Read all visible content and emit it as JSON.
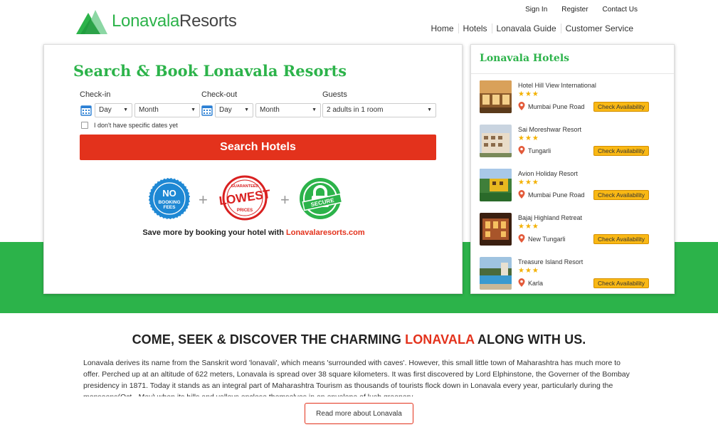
{
  "brand": {
    "name_part1": "Lonavala",
    "name_part2": "Resorts",
    "green": "#2cb34a",
    "red": "#e3321c"
  },
  "top_links": [
    "Sign In",
    "Register",
    "Contact Us"
  ],
  "main_nav": [
    "Home",
    "Hotels",
    "Lonavala Guide",
    "Customer Service"
  ],
  "search": {
    "title": "Search & Book Lonavala Resorts",
    "checkin_label": "Check-in",
    "checkout_label": "Check-out",
    "guests_label": "Guests",
    "checkin_day": "Day",
    "checkin_month": "Month",
    "checkout_day": "Day",
    "checkout_month": "Month",
    "guests_value": "2 adults in 1 room",
    "no_dates_label": "I don't have specific dates yet",
    "button_label": "Search Hotels",
    "badges": {
      "no_fees": {
        "line1": "NO",
        "line2": "BOOKING",
        "line3": "FEES"
      },
      "lowest": {
        "top": "GUARANTEED",
        "main": "LOWEST",
        "bottom": "PRICES"
      },
      "secure": {
        "main": "SECURE"
      }
    },
    "save_text": "Save more by booking your hotel with ",
    "save_link": "Lonavalaresorts.com"
  },
  "hotels": {
    "title": "Lonavala Hotels",
    "button_label": "Check Availability",
    "items": [
      {
        "name": "Hotel Hill View International",
        "stars": "★★★",
        "location": "Mumbai Pune Road"
      },
      {
        "name": "Sai Moreshwar Resort",
        "stars": "★★★",
        "location": "Tungarli"
      },
      {
        "name": "Avion Holiday Resort",
        "stars": "★★★",
        "location": "Mumbai Pune Road"
      },
      {
        "name": "Bajaj Highland Retreat",
        "stars": "★★★",
        "location": "New Tungarli"
      },
      {
        "name": "Treasure Island Resort",
        "stars": "★★★",
        "location": "Karla"
      }
    ]
  },
  "about": {
    "heading_part1": "COME, SEEK & DISCOVER THE CHARMING ",
    "heading_highlight": "LONAVALA",
    "heading_part2": " ALONG WITH US.",
    "text": "Lonavala derives its name from the Sanskrit word 'lonavali', which means 'surrounded with caves'. However, this small little town of Maharashtra has much more to offer. Perched up at an altitude of 622 meters, Lonavala is spread over 38 square kilometers. It was first discovered by Lord Elphinstone, the Governer of the Bombay presidency in 1871. Today it stands as an integral part of Maharashtra Tourism as thousands of tourists flock down in Lonavala every year, particularly during the monsoons(Oct - May) when its hills and valleys enclose themselves in an envelope of lush greenery.",
    "read_more": "Read more about Lonavala"
  }
}
